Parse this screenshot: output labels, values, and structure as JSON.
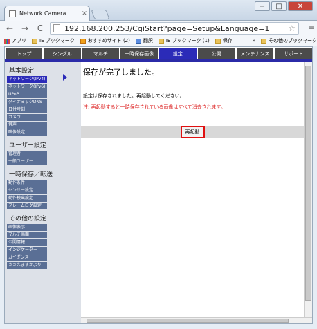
{
  "browser": {
    "tab_title": "Network Camera",
    "tab_close": "×",
    "window_buttons": [
      "−",
      "□",
      "✕"
    ],
    "back": "←",
    "forward": "→",
    "reload": "C",
    "url": "192.168.200.253/CgiStart?page=Setup&Language=1",
    "star": "☆",
    "menu": "≡",
    "bookmarks": [
      "アプリ",
      "IE ブックマーク",
      "おすすめサイト (2)",
      "翻訳",
      "IE ブックマーク (1)",
      "保存"
    ],
    "bookmarks_more": "»",
    "bookmarks_other": "その他のブックマーク"
  },
  "menu": {
    "tabs": [
      "トップ",
      "シングル",
      "マルチ",
      "一時保存画像",
      "設定",
      "公開",
      "メンテナンス",
      "サポート"
    ],
    "active_index": 4
  },
  "sidebar": {
    "groups": [
      {
        "title": "基本設定",
        "items": [
          "ネットワーク(IPv4)",
          "ネットワーク(IPv6)",
          "UPnP",
          "ダイナミックDNS",
          "日付時刻",
          "カメラ",
          "音声",
          "映像設定"
        ]
      },
      {
        "title": "ユーザー設定",
        "items": [
          "管理者",
          "一般ユーザー"
        ]
      },
      {
        "title": "一時保存／転送",
        "items": [
          "動作条件",
          "センサー設定",
          "動作検出設定",
          "フレームログ設定"
        ]
      },
      {
        "title": "その他の設定",
        "items": [
          "画像表示",
          "マルチ画面",
          "公開情報",
          "インジケーター",
          "ガイダンス",
          "ささえますかより"
        ]
      }
    ]
  },
  "content": {
    "title": "保存が完了しました。",
    "message": "設定は保存されました。再起動してください。",
    "warning": "注: 再起動すると一時保存されている画像はすべて消去されます。",
    "restart_button": "再起動"
  }
}
